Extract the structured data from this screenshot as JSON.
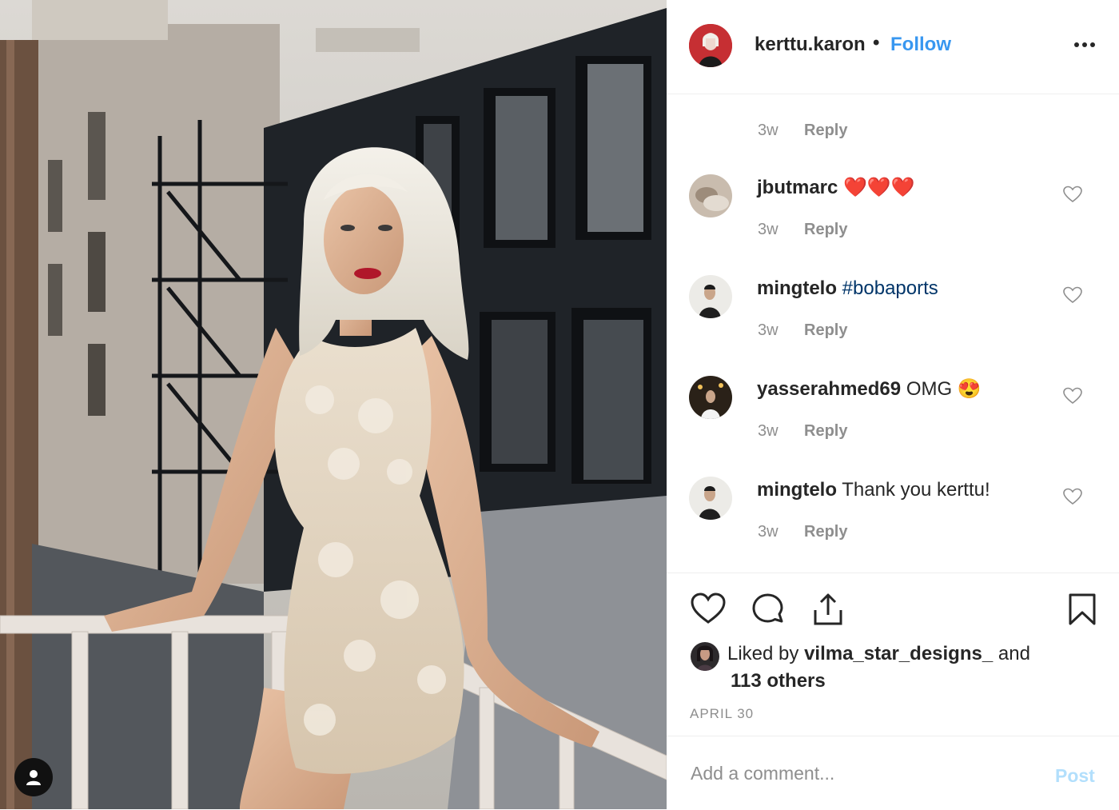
{
  "post": {
    "username": "kerttu.karon",
    "separator": "•",
    "follow_label": "Follow",
    "more_icon": "more-horizontal-icon"
  },
  "comments": [
    {
      "time": "3w",
      "reply": "Reply"
    },
    {
      "username": "jbutmarc",
      "text": "❤️❤️❤️",
      "time": "3w",
      "reply": "Reply"
    },
    {
      "username": "mingtelo",
      "text": "#bobaports",
      "time": "3w",
      "reply": "Reply"
    },
    {
      "username": "yasserahmed69",
      "text": "OMG 😍",
      "time": "3w",
      "reply": "Reply"
    },
    {
      "username": "mingtelo",
      "text": "Thank you kerttu!",
      "time": "3w",
      "reply": "Reply"
    }
  ],
  "likes": {
    "prefix": "Liked by",
    "user": "vilma_star_designs_",
    "and": "and",
    "others": "113 others"
  },
  "date": "APRIL 30",
  "composer": {
    "placeholder": "Add a comment...",
    "post_label": "Post"
  },
  "colors": {
    "link_blue": "#3897f0",
    "hashtag": "#003569",
    "muted": "#8e8e8e",
    "post_disabled": "#b2dffc"
  }
}
